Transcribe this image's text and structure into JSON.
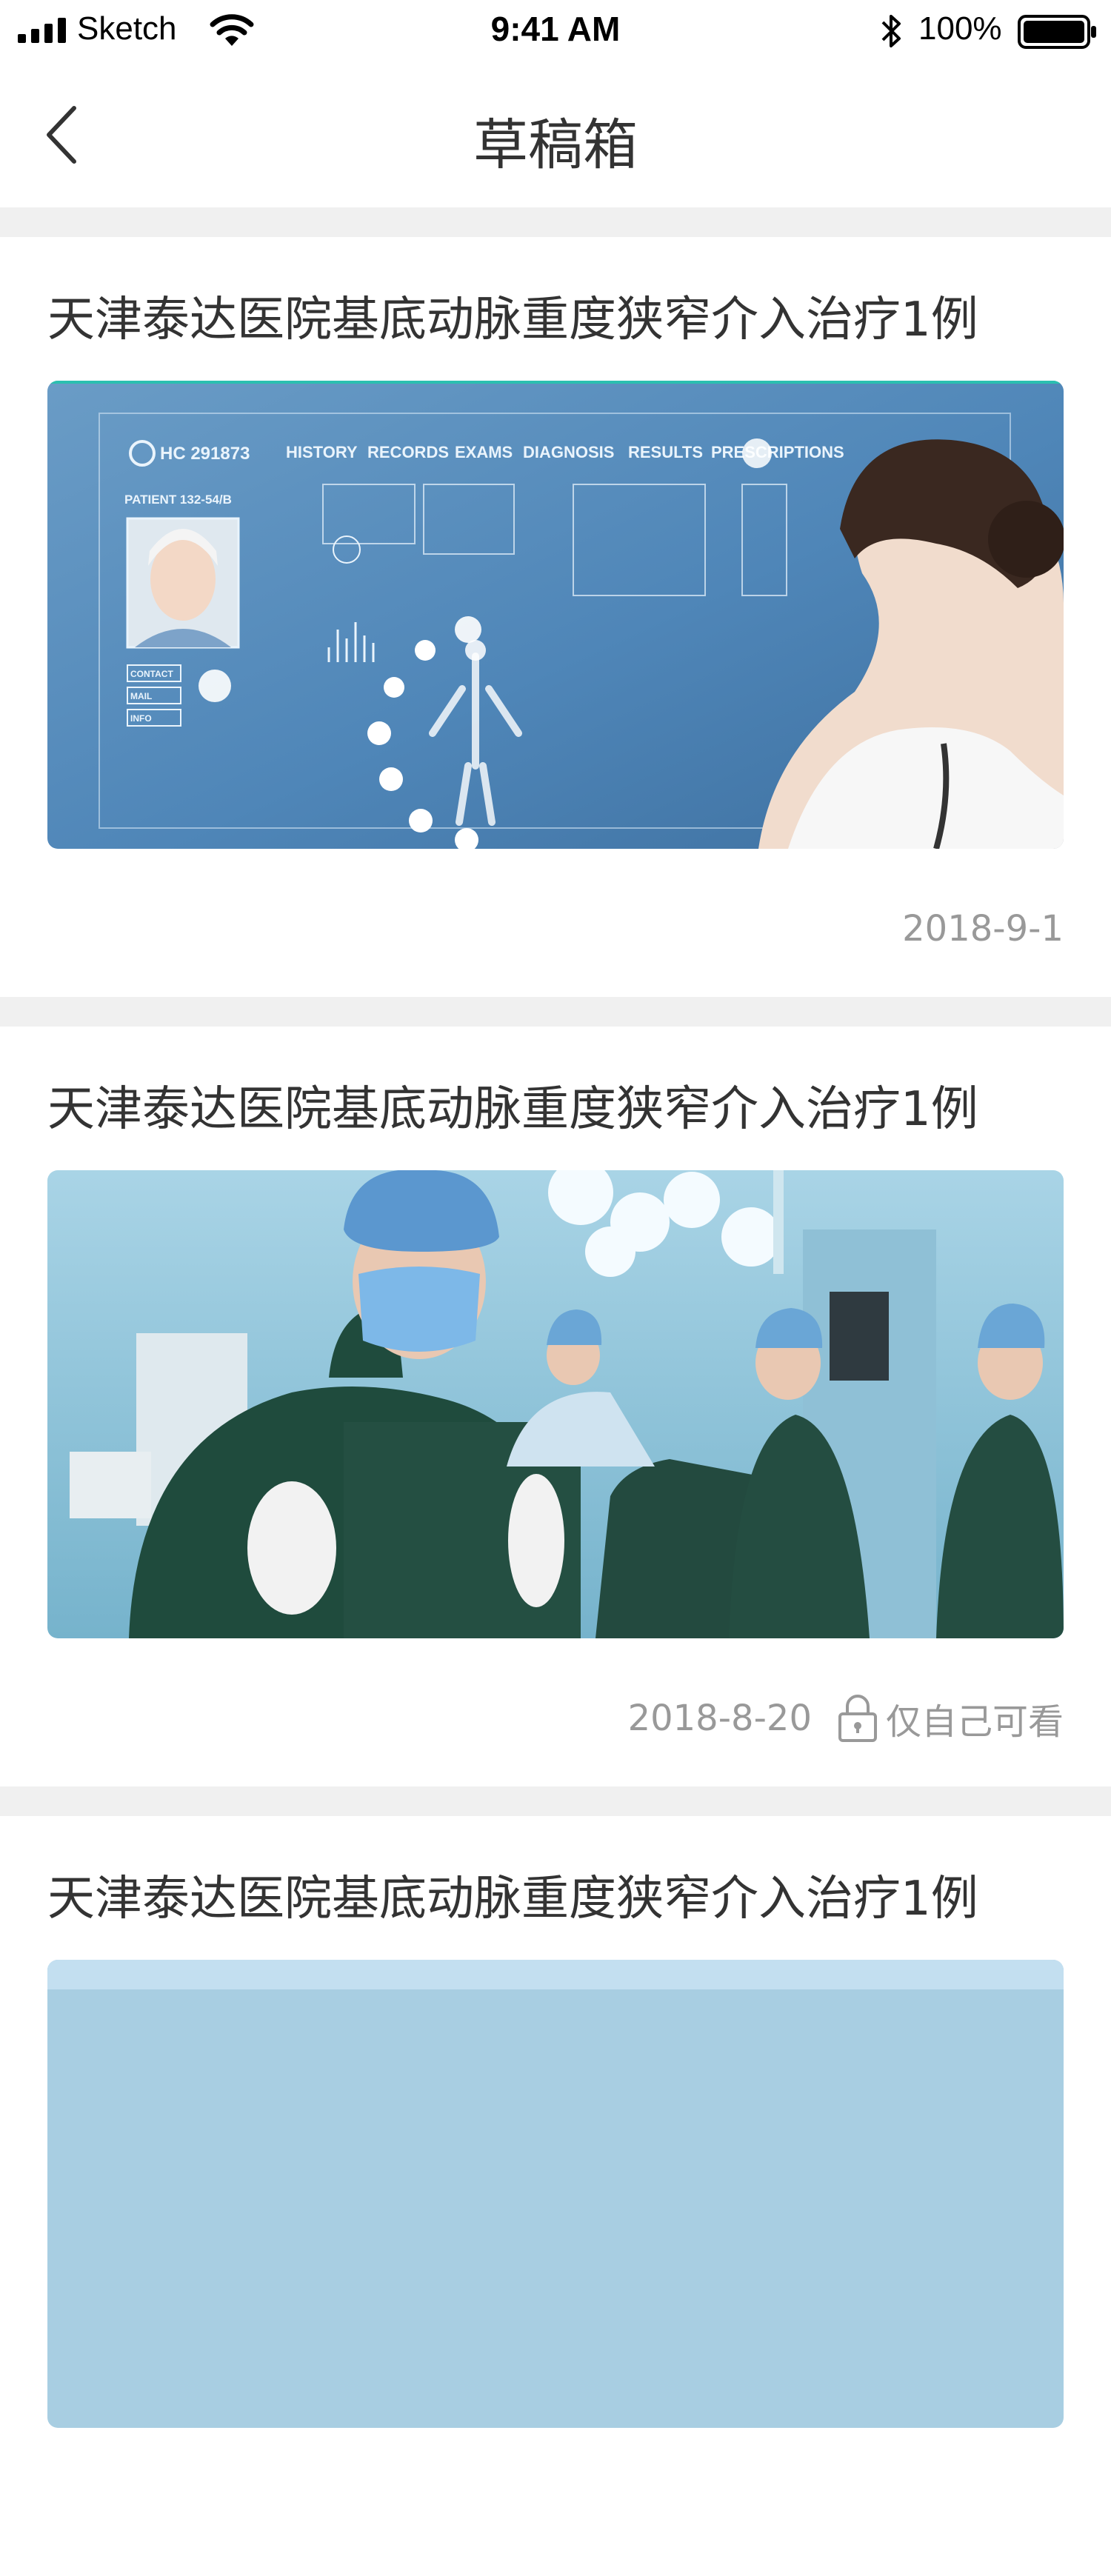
{
  "status_bar": {
    "carrier": "Sketch",
    "time": "9:41 AM",
    "battery": "100%"
  },
  "nav": {
    "title": "草稿箱",
    "back_icon": "chevron-left-icon"
  },
  "drafts": [
    {
      "title": "天津泰达医院基底动脉重度狭窄介入治疗1例",
      "date": "2018-9-1",
      "privacy": "",
      "image": "medical-interface-doctor-photo",
      "image_text": {
        "hc_code": "HC 291873",
        "menu": [
          "HISTORY",
          "RECORDS",
          "EXAMS",
          "DIAGNOSIS",
          "RESULTS",
          "PRESCRIPTIONS"
        ],
        "patient": "PATIENT 132-54/B",
        "buttons": [
          "CONTACT",
          "MAIL",
          "INFO"
        ]
      }
    },
    {
      "title": "天津泰达医院基底动脉重度狭窄介入治疗1例",
      "date": "2018-8-20",
      "privacy": "仅自己可看",
      "image": "operating-room-surgeons-photo"
    },
    {
      "title": "天津泰达医院基底动脉重度狭窄介入治疗1例",
      "date": "",
      "privacy": "",
      "image": "medical-photo-partial"
    }
  ],
  "colors": {
    "background": "#ffffff",
    "separator": "#f0f0f0",
    "title_text": "#333333",
    "meta_text": "#999999",
    "image1_accent": "#2bbfb0"
  }
}
